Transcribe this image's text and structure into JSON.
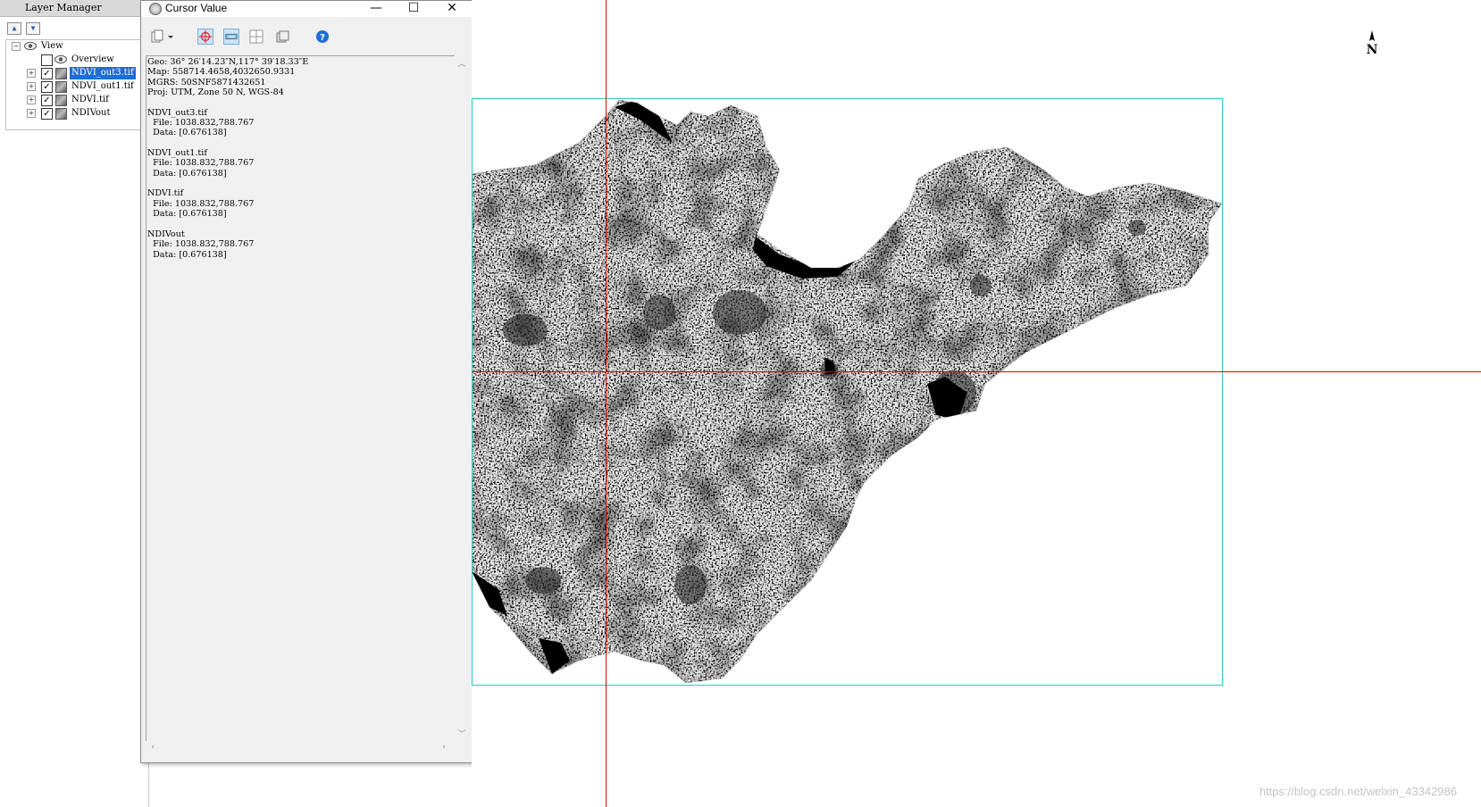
{
  "layer_manager": {
    "title": "Layer Manager",
    "tree": {
      "root": "View",
      "items": [
        {
          "label": "Overview",
          "checked": false,
          "selected": false,
          "icon": "eye-icon"
        },
        {
          "label": "NDVI_out3.tif",
          "checked": true,
          "selected": true,
          "icon": "raster-layer-icon"
        },
        {
          "label": "NDVI_out1.tif",
          "checked": true,
          "selected": false,
          "icon": "raster-layer-icon"
        },
        {
          "label": "NDVI.tif",
          "checked": true,
          "selected": false,
          "icon": "raster-layer-icon"
        },
        {
          "label": "NDIVout",
          "checked": true,
          "selected": false,
          "icon": "raster-layer-icon"
        }
      ]
    }
  },
  "cursor_window": {
    "title": "Cursor Value",
    "controls": {
      "minimize": "—",
      "maximize": "☐",
      "close": "✕"
    },
    "geo": "Geo: 36° 26′14.23″N,117° 39′18.33″E",
    "map": "Map: 558714.4658,4032650.9331",
    "mgrs": "MGRS: 50SNF5871432651",
    "proj": "Proj: UTM, Zone 50 N, WGS-84",
    "layers": [
      {
        "name": "NDVI_out3.tif",
        "file": "  File: 1038.832,788.767",
        "data": "  Data: [0.676138]"
      },
      {
        "name": "NDVI_out1.tif",
        "file": "  File: 1038.832,788.767",
        "data": "  Data: [0.676138]"
      },
      {
        "name": "NDVI.tif",
        "file": "  File: 1038.832,788.767",
        "data": "  Data: [0.676138]"
      },
      {
        "name": "NDIVout",
        "file": "  File: 1038.832,788.767",
        "data": "  Data: [0.676138]"
      }
    ]
  },
  "map": {
    "north_label": "N",
    "crosshair_color": "#e60000",
    "extent_color": "#2cc7c7"
  },
  "watermark": "https://blog.csdn.net/weixin_43342986"
}
